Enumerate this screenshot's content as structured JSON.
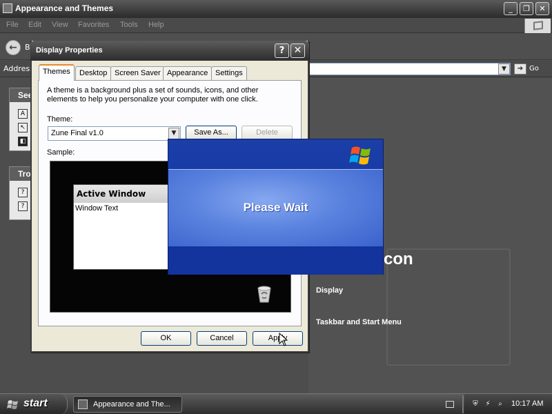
{
  "explorer": {
    "title": "Appearance and Themes",
    "menu": [
      "File",
      "Edit",
      "View",
      "Favorites",
      "Tools",
      "Help"
    ],
    "back_label": "B",
    "address_label": "Address",
    "go_label": "Go",
    "see_also_heading": "See",
    "troubleshooter_heading": "Tro",
    "icon_heading": "con",
    "links": {
      "display": "Display",
      "taskbar": "Taskbar and Start Menu"
    }
  },
  "dialog": {
    "title": "Display Properties",
    "help_icon": "?",
    "close_icon": "✕",
    "tabs": [
      "Themes",
      "Desktop",
      "Screen Saver",
      "Appearance",
      "Settings"
    ],
    "description": "A theme is a background plus a set of sounds, icons, and other elements to help you personalize your computer with one click.",
    "theme_label": "Theme:",
    "theme_value": "Zune Final v1.0",
    "save_as": "Save As...",
    "delete": "Delete",
    "sample_label": "Sample:",
    "sample_window_title": "Active Window",
    "sample_window_text": "Window Text",
    "ok": "OK",
    "cancel": "Cancel",
    "apply": "Apply"
  },
  "please_wait": {
    "text": "Please Wait"
  },
  "taskbar": {
    "start": "start",
    "task_item": "Appearance and The...",
    "clock": "10:17 AM"
  },
  "colors": {
    "please_wait_blue": "#3a62cc",
    "titlebar_dark": "#2d2d2d",
    "dialog_face": "#ece9d8",
    "active_tab_accent": "#e68b2c"
  }
}
